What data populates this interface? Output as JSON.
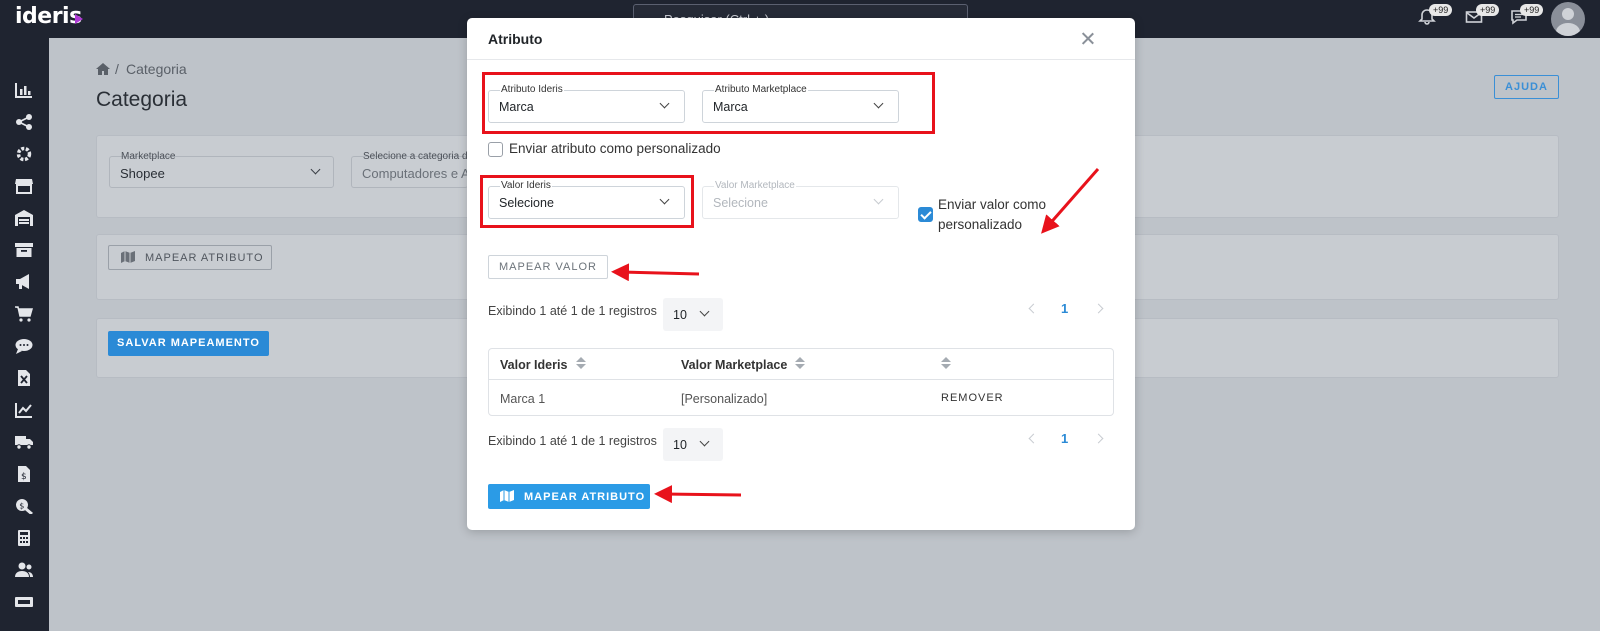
{
  "app": {
    "logo": "ideris"
  },
  "topbar": {
    "search_placeholder": "Pesquisar (Ctrl + )",
    "notifications_badge": "+99",
    "messages_badge": "+99",
    "chat_badge": "+99"
  },
  "sidebar": {
    "icons": [
      "chart-bar-icon",
      "share-nodes-icon",
      "gear-icon",
      "store-icon",
      "warehouse-icon",
      "archive-box-icon",
      "megaphone-icon",
      "cart-icon",
      "chat-bubble-icon",
      "excel-file-icon",
      "line-chart-icon",
      "truck-icon",
      "invoice-file-icon",
      "search-dollar-icon",
      "calculator-icon",
      "users-icon",
      "ticket-icon"
    ]
  },
  "page": {
    "breadcrumb": "Categoria",
    "breadcrumb_separator": "/",
    "title": "Categoria",
    "help_button": "AJUDA",
    "marketplace_label": "Marketplace",
    "marketplace_value": "Shopee",
    "category_label": "Selecione a categoria d",
    "category_value": "Computadores e Ac",
    "map_attribute_button": "MAPEAR ATRIBUTO",
    "save_mapping_button": "SALVAR MAPEAMENTO"
  },
  "modal": {
    "title": "Atributo",
    "attr_ideris": {
      "label": "Atributo Ideris",
      "value": "Marca"
    },
    "attr_marketplace": {
      "label": "Atributo Marketplace",
      "value": "Marca"
    },
    "send_attr_custom": {
      "label": "Enviar atributo como personalizado",
      "checked": false
    },
    "value_ideris": {
      "label": "Valor Ideris",
      "value": "Selecione"
    },
    "value_marketplace": {
      "label": "Valor Marketplace",
      "value": "Selecione",
      "disabled": true
    },
    "send_value_custom": {
      "label_line1": "Enviar valor como",
      "label_line2": "personalizado",
      "checked": true
    },
    "map_value_button": "MAPEAR VALOR",
    "table_info": "Exibindo 1 até 1 de 1 registros",
    "page_size": "10",
    "current_page": "1",
    "table": {
      "headers": [
        "Valor Ideris",
        "Valor Marketplace",
        ""
      ],
      "rows": [
        {
          "valor_ideris": "Marca 1",
          "valor_marketplace": "[Personalizado]",
          "action": "REMOVER"
        }
      ]
    },
    "map_attribute_button": "MAPEAR ATRIBUTO"
  },
  "colors": {
    "accent": "#2b9be6",
    "topbar": "#1f2430",
    "annotation": "#e8121b",
    "logo_mark": "#b03ad6"
  }
}
